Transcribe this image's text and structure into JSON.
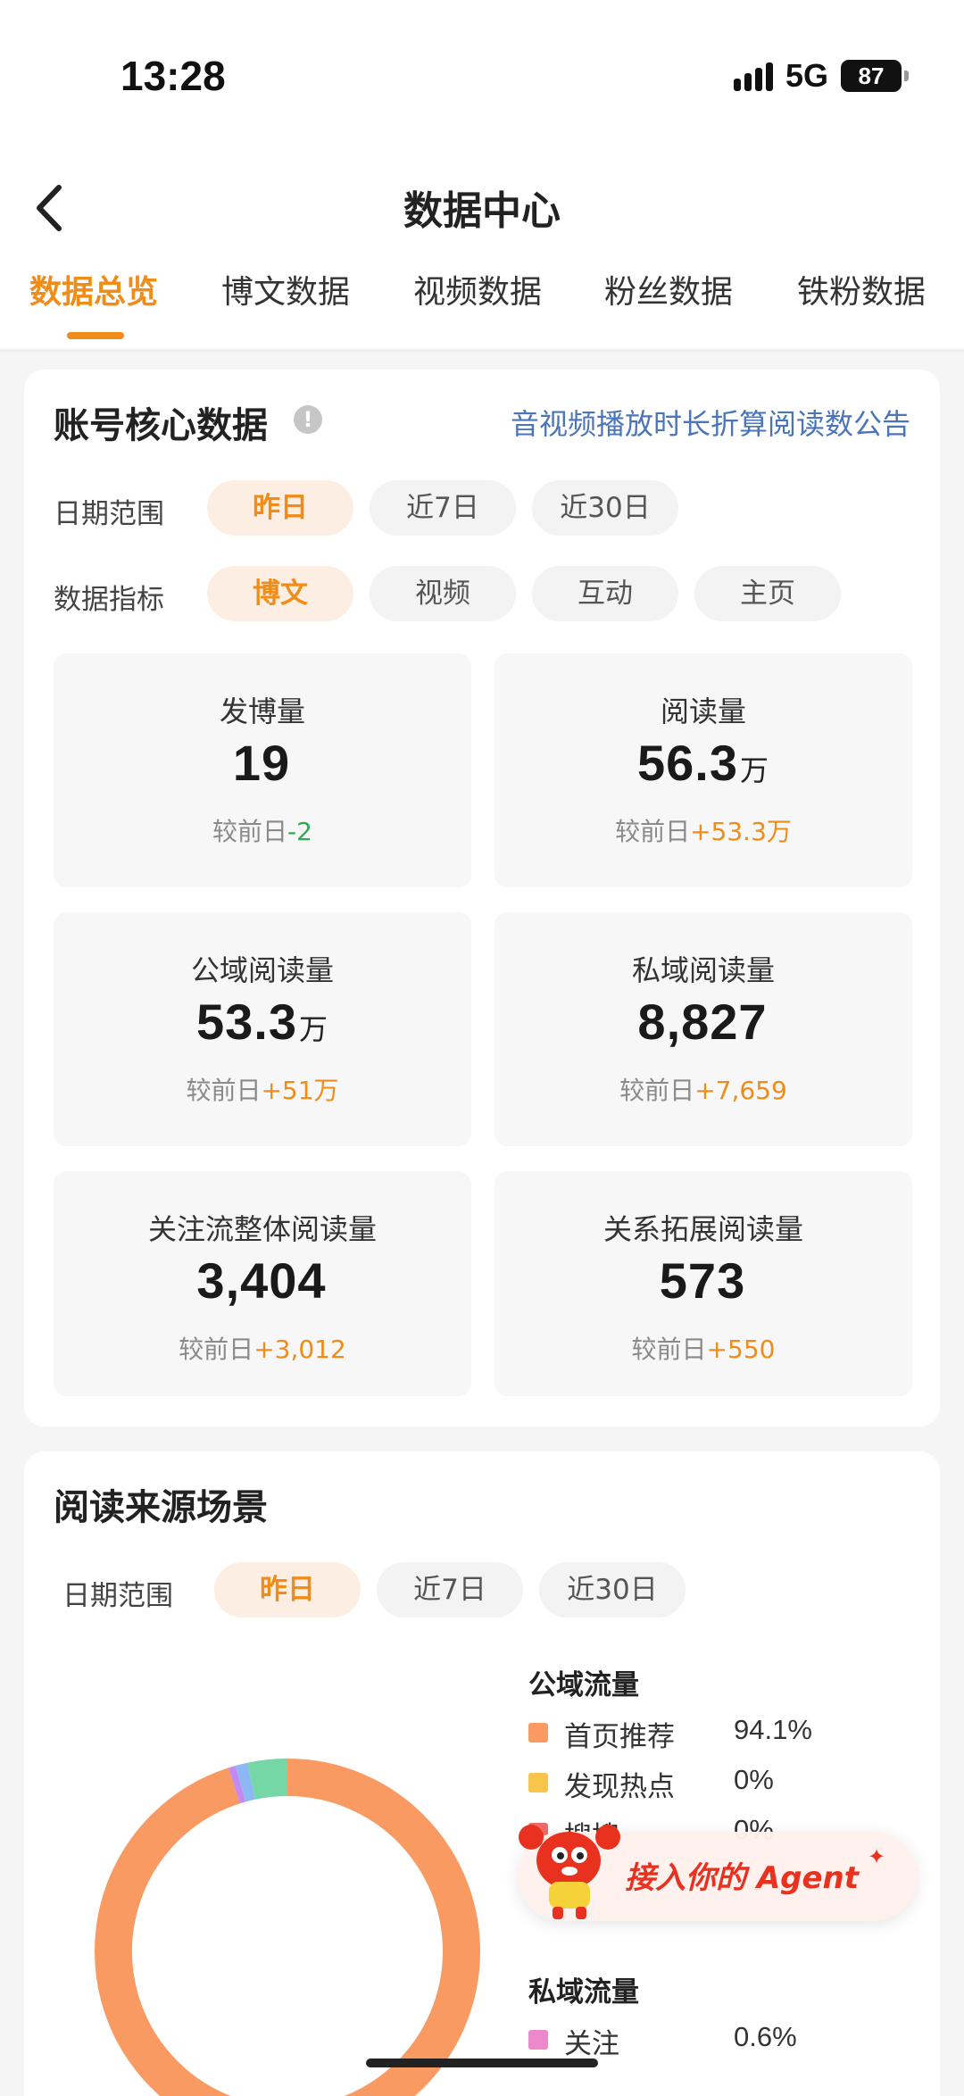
{
  "status_bar": {
    "time": "13:28",
    "network": "5G",
    "battery": "87"
  },
  "header": {
    "title": "数据中心"
  },
  "tabs": [
    {
      "label": "数据总览",
      "active": true
    },
    {
      "label": "博文数据",
      "active": false
    },
    {
      "label": "视频数据",
      "active": false
    },
    {
      "label": "粉丝数据",
      "active": false
    },
    {
      "label": "铁粉数据",
      "active": false
    }
  ],
  "core": {
    "title": "账号核心数据",
    "info_icon": "info-icon",
    "notice_link": "音视频播放时长折算阅读数公告",
    "date_label": "日期范围",
    "date_options": [
      "昨日",
      "近7日",
      "近30日"
    ],
    "date_selected": "昨日",
    "metric_label": "数据指标",
    "metric_options": [
      "博文",
      "视频",
      "互动",
      "主页"
    ],
    "metric_selected": "博文",
    "stats": [
      {
        "label": "发博量",
        "value": "19",
        "unit": "",
        "cmp_prefix": "较前日",
        "cmp_value": "-2",
        "trend": "down"
      },
      {
        "label": "阅读量",
        "value": "56.3",
        "unit": "万",
        "cmp_prefix": "较前日",
        "cmp_value": "+53.3万",
        "trend": "up"
      },
      {
        "label": "公域阅读量",
        "value": "53.3",
        "unit": "万",
        "cmp_prefix": "较前日",
        "cmp_value": "+51万",
        "trend": "up"
      },
      {
        "label": "私域阅读量",
        "value": "8,827",
        "unit": "",
        "cmp_prefix": "较前日",
        "cmp_value": "+7,659",
        "trend": "up"
      },
      {
        "label": "关注流整体阅读量",
        "value": "3,404",
        "unit": "",
        "cmp_prefix": "较前日",
        "cmp_value": "+3,012",
        "trend": "up"
      },
      {
        "label": "关系拓展阅读量",
        "value": "573",
        "unit": "",
        "cmp_prefix": "较前日",
        "cmp_value": "+550",
        "trend": "up"
      }
    ]
  },
  "source": {
    "title": "阅读来源场景",
    "date_label": "日期范围",
    "date_options": [
      "昨日",
      "近7日",
      "近30日"
    ],
    "date_selected": "昨日",
    "public_group": "公域流量",
    "private_group": "私域流量",
    "public_items": [
      {
        "name": "首页推荐",
        "pct": "94.1%",
        "color": "#f99a62"
      },
      {
        "name": "发现热点",
        "pct": "0%",
        "color": "#f7c44c"
      },
      {
        "name": "搜搜",
        "pct": "0%",
        "color": "#ef6b6b"
      }
    ],
    "private_items": [
      {
        "name": "关注",
        "pct": "0.6%",
        "color": "#ee88cc"
      }
    ]
  },
  "chart_data": {
    "type": "pie",
    "title": "",
    "donut": true,
    "slices": [
      {
        "label": "首页推荐",
        "value": 94.1,
        "color": "#f99a62"
      },
      {
        "label": "关注",
        "value": 0.6,
        "color": "#c38bf0"
      },
      {
        "label": "未标注",
        "value": 1.0,
        "color": "#8cb8f5"
      },
      {
        "label": "未标注",
        "value": 3.3,
        "color": "#75d6a6"
      }
    ]
  },
  "agent_float": {
    "label": "接入你的 Agent",
    "spark": "✦"
  }
}
